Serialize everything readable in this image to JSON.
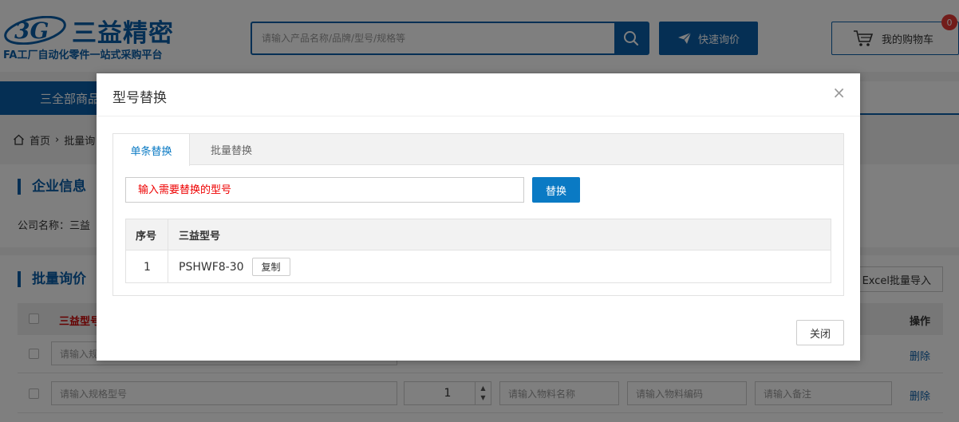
{
  "header": {
    "logo_mark": "3G",
    "logo_name": "三益精密",
    "logo_slogan": "FA工厂自动化零件一站式采购平台",
    "search_placeholder": "请输入产品名称/品牌/型号/规格等",
    "quick_inquiry_label": "快速询价",
    "cart_label": "我的购物车",
    "cart_count": "0",
    "accent_color": "#0a5ea8"
  },
  "nav": {
    "all_products_label": "三全部商品"
  },
  "breadcrumb": {
    "home": "首页",
    "current": "批量询"
  },
  "company_panel": {
    "title": "企业信息",
    "company_label": "公司名称：三益"
  },
  "inquiry_panel": {
    "title": "批量询价",
    "excel_import_label": "Excel批量导入",
    "col_model": "三益型号",
    "col_operation": "操作",
    "rows": [
      {
        "spec_placeholder": "请输入规",
        "delete_label": "删除"
      },
      {
        "spec_placeholder": "请输入规格型号",
        "quantity": "1",
        "material_name_placeholder": "请输入物料名称",
        "material_code_placeholder": "请输入物料编码",
        "note_placeholder": "请输入备注",
        "delete_label": "删除"
      }
    ]
  },
  "modal": {
    "title": "型号替换",
    "close_symbol": "×",
    "tabs": [
      {
        "label": "单条替换",
        "active": true
      },
      {
        "label": "批量替换",
        "active": false
      }
    ],
    "input_placeholder": "输入需要替换的型号",
    "replace_button": "替换",
    "table": {
      "col_index": "序号",
      "col_model": "三益型号",
      "rows": [
        {
          "index": "1",
          "model": "PSHWF8-30",
          "copy_label": "复制"
        }
      ]
    },
    "footer_close": "关闭",
    "link_color": "#0a7ac4"
  }
}
